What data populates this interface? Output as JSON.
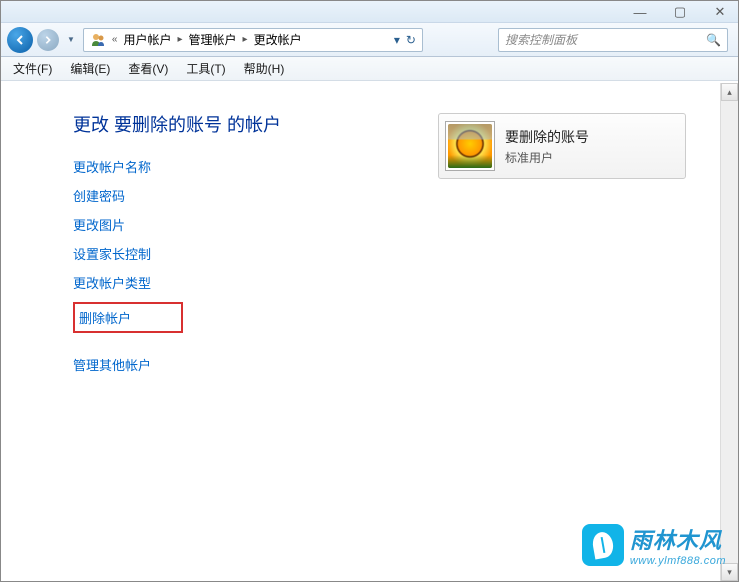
{
  "window_controls": {
    "min": "—",
    "max": "▢",
    "close": "✕"
  },
  "breadcrumb": {
    "double_chev": "«",
    "items": [
      "用户帐户",
      "管理帐户",
      "更改帐户"
    ],
    "sep": "▸",
    "dropdown": "▾",
    "refresh": "↻"
  },
  "search": {
    "placeholder": "搜索控制面板",
    "icon": "🔍"
  },
  "menu": [
    {
      "label": "文件(F)"
    },
    {
      "label": "编辑(E)"
    },
    {
      "label": "查看(V)"
    },
    {
      "label": "工具(T)"
    },
    {
      "label": "帮助(H)"
    }
  ],
  "heading": "更改 要删除的账号 的帐户",
  "links": [
    "更改帐户名称",
    "创建密码",
    "更改图片",
    "设置家长控制",
    "更改帐户类型",
    "删除帐户"
  ],
  "links2": [
    "管理其他帐户"
  ],
  "account": {
    "name": "要删除的账号",
    "type": "标准用户"
  },
  "watermark": {
    "cn": "雨林木风",
    "url": "www.ylmf888.com"
  },
  "scrollbar": {
    "up": "▴",
    "down": "▾"
  }
}
